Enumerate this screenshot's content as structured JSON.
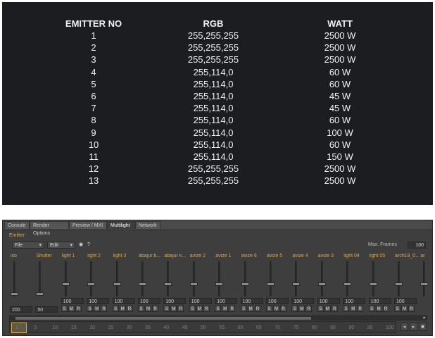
{
  "table": {
    "headers": [
      "EMITTER NO",
      "RGB",
      "WATT"
    ],
    "rows": [
      [
        "1",
        "255,255,255",
        "2500 W"
      ],
      [
        "2",
        "255,255,255",
        "2500 W"
      ],
      [
        "3",
        "255,255,255",
        "2500 W"
      ],
      [
        "4",
        "255,114,0",
        "60 W"
      ],
      [
        "5",
        "255,114,0",
        "60 W"
      ],
      [
        "6",
        "255,114,0",
        "45 W"
      ],
      [
        "7",
        "255,114,0",
        "45 W"
      ],
      [
        "8",
        "255,114,0",
        "60 W"
      ],
      [
        "9",
        "255,114,0",
        "100 W"
      ],
      [
        "10",
        "255,114,0",
        "60 W"
      ],
      [
        "11",
        "255,114,0",
        "150 W"
      ],
      [
        "12",
        "255,255,255",
        "2500 W"
      ],
      [
        "13",
        "255,255,255",
        "2500 W"
      ]
    ]
  },
  "app": {
    "tabs": [
      "Console",
      "Render Options",
      "Preview / MXI",
      "Multilight",
      "Network"
    ],
    "active_tab": "Multilight",
    "section_label": "Emitter",
    "toolbar": {
      "file_label": "File",
      "edit_label": "Edit",
      "max_frames_label": "Max. Frames",
      "max_frames_value": "100"
    },
    "channels": [
      {
        "name": "iso",
        "value": "200"
      },
      {
        "name": "Shutter",
        "value": "50"
      },
      {
        "name": "light 1",
        "value": "100"
      },
      {
        "name": "light 2",
        "value": "100"
      },
      {
        "name": "light 3",
        "value": "100"
      },
      {
        "name": "abajur b...",
        "value": "100"
      },
      {
        "name": "abajur k...",
        "value": "100"
      },
      {
        "name": "avize 2",
        "value": "100"
      },
      {
        "name": "avize 1",
        "value": "100"
      },
      {
        "name": "avize 6",
        "value": "100"
      },
      {
        "name": "avize 5",
        "value": "100"
      },
      {
        "name": "avize 4",
        "value": "100"
      },
      {
        "name": "avize 3",
        "value": "100"
      },
      {
        "name": "light 04",
        "value": "100"
      },
      {
        "name": "light 05",
        "value": "100"
      },
      {
        "name": "arch19_0...",
        "value": "100"
      },
      {
        "name": "ar",
        "value": ""
      }
    ],
    "smr_labels": [
      "S",
      "M",
      "R"
    ],
    "timeline_ticks": [
      "1",
      "5",
      "10",
      "15",
      "20",
      "25",
      "30",
      "35",
      "40",
      "45",
      "50",
      "55",
      "60",
      "65",
      "70",
      "75",
      "80",
      "85",
      "90",
      "95",
      "100"
    ],
    "timeline_value": "1",
    "accent_color": "#d9a84e"
  }
}
